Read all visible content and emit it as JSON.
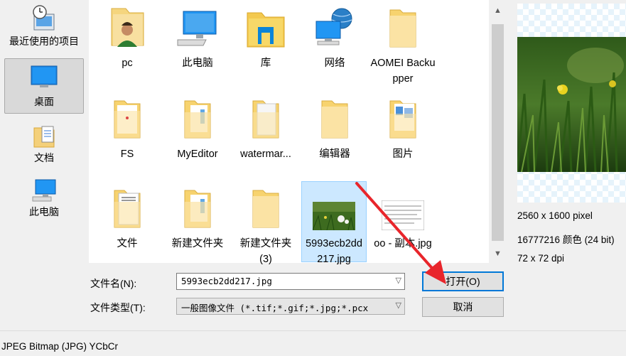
{
  "places": [
    {
      "label": "最近使用的项目",
      "icon": "recent-items-icon"
    },
    {
      "label": "桌面",
      "icon": "desktop-icon",
      "selected": true
    },
    {
      "label": "文档",
      "icon": "documents-icon"
    },
    {
      "label": "此电脑",
      "icon": "this-pc-icon"
    }
  ],
  "files": [
    {
      "name": "pc",
      "icon": "user-folder-icon"
    },
    {
      "name": "此电脑",
      "icon": "computer-icon"
    },
    {
      "name": "库",
      "icon": "library-icon"
    },
    {
      "name": "网络",
      "icon": "network-icon"
    },
    {
      "name": "AOMEI Backupper",
      "icon": "folder-icon"
    },
    {
      "name": "FS",
      "icon": "folder-icon"
    },
    {
      "name": "MyEditor",
      "icon": "folder-icon"
    },
    {
      "name": "watermar...",
      "icon": "folder-icon"
    },
    {
      "name": "编辑器",
      "icon": "folder-icon"
    },
    {
      "name": "图片",
      "icon": "folder-icon"
    },
    {
      "name": "文件",
      "icon": "folder-icon"
    },
    {
      "name": "新建文件夹",
      "icon": "folder-icon"
    },
    {
      "name": "新建文件夹 (3)",
      "icon": "folder-icon"
    },
    {
      "name": "5993ecb2dd217.jpg",
      "icon": "image-thumbnail",
      "selected": true
    },
    {
      "name": "oo - 副本.jpg",
      "icon": "image-thumbnail"
    }
  ],
  "preview_info": {
    "dimensions": "2560 x 1600 pixel",
    "colors": "16777216 颜色 (24 bit)",
    "dpi": "72 x 72 dpi"
  },
  "filename": {
    "label": "文件名(N):",
    "value": "5993ecb2dd217.jpg"
  },
  "filetype": {
    "label": "文件类型(T):",
    "value": "一般图像文件 (*.tif;*.gif;*.jpg;*.pcx"
  },
  "buttons": {
    "open": "打开(O)",
    "cancel": "取消"
  },
  "status_bar": "JPEG Bitmap (JPG) YCbCr",
  "colors": {
    "accent": "#0078d7",
    "selection": "#cce8ff",
    "annotation_arrow": "#e8252b"
  }
}
